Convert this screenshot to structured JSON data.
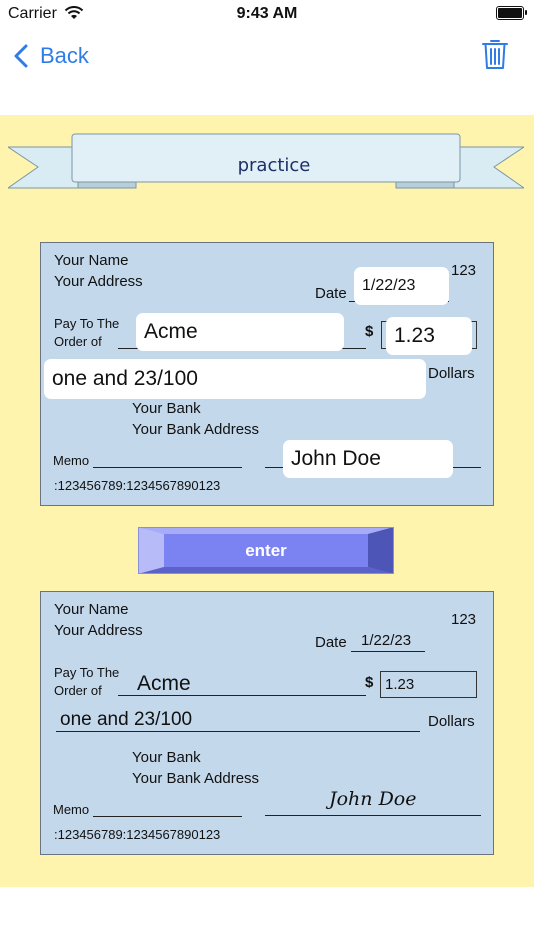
{
  "status_bar": {
    "carrier": "Carrier",
    "time": "9:43 AM"
  },
  "nav": {
    "back_label": "Back"
  },
  "banner": {
    "title": "practice"
  },
  "check_template": {
    "name": "Your Name",
    "address": "Your Address",
    "check_number": "123",
    "date_label": "Date",
    "pay_to_line1": "Pay To The",
    "pay_to_line2": "Order of",
    "dollar_sign": "$",
    "dollars_label": "Dollars",
    "bank_name": "Your Bank",
    "bank_address": "Your Bank Address",
    "memo_label": "Memo",
    "routing": ":123456789:1234567890123"
  },
  "input_check": {
    "date": "1/22/23",
    "payee": "Acme",
    "amount": "1.23",
    "written_amount": "one and 23/100",
    "signature": "John Doe"
  },
  "enter_button": {
    "label": "enter"
  },
  "result_check": {
    "date": "1/22/23",
    "payee": "Acme",
    "amount": "1.23",
    "written_amount": "one and 23/100",
    "signature": "John Doe"
  },
  "colors": {
    "accent": "#2f7ce8",
    "panel": "#fff4ad",
    "check": "#c4d8ec",
    "button": "#7b83f2"
  }
}
